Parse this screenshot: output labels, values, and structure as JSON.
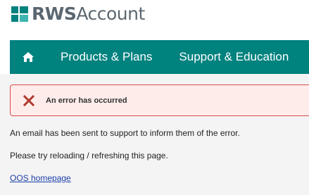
{
  "header": {
    "logo_rws": "RWS",
    "logo_account": "Account"
  },
  "nav": {
    "home_icon": "home-icon",
    "items": [
      {
        "label": "Products & Plans"
      },
      {
        "label": "Support & Education"
      }
    ]
  },
  "error": {
    "icon": "close-icon",
    "message": "An error has occurred"
  },
  "content": {
    "paragraph_1": "An email has been sent to support to inform them of the error.",
    "paragraph_2": "Please try reloading / refreshing this page.",
    "link_label": "OOS homepage"
  },
  "colors": {
    "nav_background": "#00827f",
    "logo_gray": "#5b6770",
    "error_red": "#c0392b",
    "error_background": "#fdecea",
    "link_blue": "#1a3ea8"
  }
}
